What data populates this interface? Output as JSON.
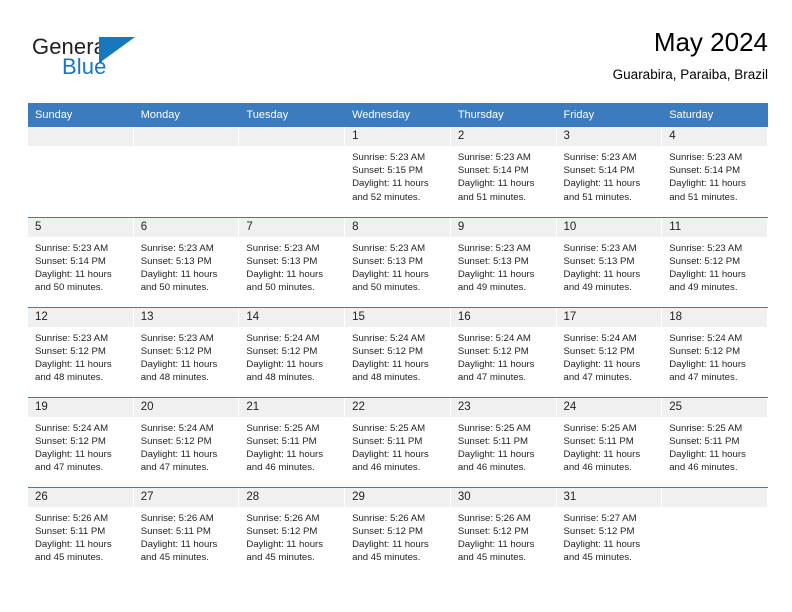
{
  "brand": {
    "name_top": "General",
    "name_bottom": "Blue",
    "flag_icon": "triangle-flag-icon",
    "accent_color": "#1878be"
  },
  "header": {
    "title": "May 2024",
    "subtitle": "Guarabira, Paraiba, Brazil"
  },
  "theme": {
    "header_blue": "#3b7cbf",
    "daynum_band": "#f0f0f0",
    "text": "#231f20"
  },
  "weekday_headers": [
    "Sunday",
    "Monday",
    "Tuesday",
    "Wednesday",
    "Thursday",
    "Friday",
    "Saturday"
  ],
  "labels": {
    "sunrise_prefix": "Sunrise:",
    "sunset_prefix": "Sunset:",
    "daylight_prefix": "Daylight:"
  },
  "weeks": [
    [
      {
        "day": "",
        "empty": true
      },
      {
        "day": "",
        "empty": true
      },
      {
        "day": "",
        "empty": true
      },
      {
        "day": "1",
        "sunrise": "Sunrise: 5:23 AM",
        "sunset": "Sunset: 5:15 PM",
        "daylight_l1": "Daylight: 11 hours",
        "daylight_l2": "and 52 minutes."
      },
      {
        "day": "2",
        "sunrise": "Sunrise: 5:23 AM",
        "sunset": "Sunset: 5:14 PM",
        "daylight_l1": "Daylight: 11 hours",
        "daylight_l2": "and 51 minutes."
      },
      {
        "day": "3",
        "sunrise": "Sunrise: 5:23 AM",
        "sunset": "Sunset: 5:14 PM",
        "daylight_l1": "Daylight: 11 hours",
        "daylight_l2": "and 51 minutes."
      },
      {
        "day": "4",
        "sunrise": "Sunrise: 5:23 AM",
        "sunset": "Sunset: 5:14 PM",
        "daylight_l1": "Daylight: 11 hours",
        "daylight_l2": "and 51 minutes."
      }
    ],
    [
      {
        "day": "5",
        "sunrise": "Sunrise: 5:23 AM",
        "sunset": "Sunset: 5:14 PM",
        "daylight_l1": "Daylight: 11 hours",
        "daylight_l2": "and 50 minutes."
      },
      {
        "day": "6",
        "sunrise": "Sunrise: 5:23 AM",
        "sunset": "Sunset: 5:13 PM",
        "daylight_l1": "Daylight: 11 hours",
        "daylight_l2": "and 50 minutes."
      },
      {
        "day": "7",
        "sunrise": "Sunrise: 5:23 AM",
        "sunset": "Sunset: 5:13 PM",
        "daylight_l1": "Daylight: 11 hours",
        "daylight_l2": "and 50 minutes."
      },
      {
        "day": "8",
        "sunrise": "Sunrise: 5:23 AM",
        "sunset": "Sunset: 5:13 PM",
        "daylight_l1": "Daylight: 11 hours",
        "daylight_l2": "and 50 minutes."
      },
      {
        "day": "9",
        "sunrise": "Sunrise: 5:23 AM",
        "sunset": "Sunset: 5:13 PM",
        "daylight_l1": "Daylight: 11 hours",
        "daylight_l2": "and 49 minutes."
      },
      {
        "day": "10",
        "sunrise": "Sunrise: 5:23 AM",
        "sunset": "Sunset: 5:13 PM",
        "daylight_l1": "Daylight: 11 hours",
        "daylight_l2": "and 49 minutes."
      },
      {
        "day": "11",
        "sunrise": "Sunrise: 5:23 AM",
        "sunset": "Sunset: 5:12 PM",
        "daylight_l1": "Daylight: 11 hours",
        "daylight_l2": "and 49 minutes."
      }
    ],
    [
      {
        "day": "12",
        "sunrise": "Sunrise: 5:23 AM",
        "sunset": "Sunset: 5:12 PM",
        "daylight_l1": "Daylight: 11 hours",
        "daylight_l2": "and 48 minutes."
      },
      {
        "day": "13",
        "sunrise": "Sunrise: 5:23 AM",
        "sunset": "Sunset: 5:12 PM",
        "daylight_l1": "Daylight: 11 hours",
        "daylight_l2": "and 48 minutes."
      },
      {
        "day": "14",
        "sunrise": "Sunrise: 5:24 AM",
        "sunset": "Sunset: 5:12 PM",
        "daylight_l1": "Daylight: 11 hours",
        "daylight_l2": "and 48 minutes."
      },
      {
        "day": "15",
        "sunrise": "Sunrise: 5:24 AM",
        "sunset": "Sunset: 5:12 PM",
        "daylight_l1": "Daylight: 11 hours",
        "daylight_l2": "and 48 minutes."
      },
      {
        "day": "16",
        "sunrise": "Sunrise: 5:24 AM",
        "sunset": "Sunset: 5:12 PM",
        "daylight_l1": "Daylight: 11 hours",
        "daylight_l2": "and 47 minutes."
      },
      {
        "day": "17",
        "sunrise": "Sunrise: 5:24 AM",
        "sunset": "Sunset: 5:12 PM",
        "daylight_l1": "Daylight: 11 hours",
        "daylight_l2": "and 47 minutes."
      },
      {
        "day": "18",
        "sunrise": "Sunrise: 5:24 AM",
        "sunset": "Sunset: 5:12 PM",
        "daylight_l1": "Daylight: 11 hours",
        "daylight_l2": "and 47 minutes."
      }
    ],
    [
      {
        "day": "19",
        "sunrise": "Sunrise: 5:24 AM",
        "sunset": "Sunset: 5:12 PM",
        "daylight_l1": "Daylight: 11 hours",
        "daylight_l2": "and 47 minutes."
      },
      {
        "day": "20",
        "sunrise": "Sunrise: 5:24 AM",
        "sunset": "Sunset: 5:12 PM",
        "daylight_l1": "Daylight: 11 hours",
        "daylight_l2": "and 47 minutes."
      },
      {
        "day": "21",
        "sunrise": "Sunrise: 5:25 AM",
        "sunset": "Sunset: 5:11 PM",
        "daylight_l1": "Daylight: 11 hours",
        "daylight_l2": "and 46 minutes."
      },
      {
        "day": "22",
        "sunrise": "Sunrise: 5:25 AM",
        "sunset": "Sunset: 5:11 PM",
        "daylight_l1": "Daylight: 11 hours",
        "daylight_l2": "and 46 minutes."
      },
      {
        "day": "23",
        "sunrise": "Sunrise: 5:25 AM",
        "sunset": "Sunset: 5:11 PM",
        "daylight_l1": "Daylight: 11 hours",
        "daylight_l2": "and 46 minutes."
      },
      {
        "day": "24",
        "sunrise": "Sunrise: 5:25 AM",
        "sunset": "Sunset: 5:11 PM",
        "daylight_l1": "Daylight: 11 hours",
        "daylight_l2": "and 46 minutes."
      },
      {
        "day": "25",
        "sunrise": "Sunrise: 5:25 AM",
        "sunset": "Sunset: 5:11 PM",
        "daylight_l1": "Daylight: 11 hours",
        "daylight_l2": "and 46 minutes."
      }
    ],
    [
      {
        "day": "26",
        "sunrise": "Sunrise: 5:26 AM",
        "sunset": "Sunset: 5:11 PM",
        "daylight_l1": "Daylight: 11 hours",
        "daylight_l2": "and 45 minutes."
      },
      {
        "day": "27",
        "sunrise": "Sunrise: 5:26 AM",
        "sunset": "Sunset: 5:11 PM",
        "daylight_l1": "Daylight: 11 hours",
        "daylight_l2": "and 45 minutes."
      },
      {
        "day": "28",
        "sunrise": "Sunrise: 5:26 AM",
        "sunset": "Sunset: 5:12 PM",
        "daylight_l1": "Daylight: 11 hours",
        "daylight_l2": "and 45 minutes."
      },
      {
        "day": "29",
        "sunrise": "Sunrise: 5:26 AM",
        "sunset": "Sunset: 5:12 PM",
        "daylight_l1": "Daylight: 11 hours",
        "daylight_l2": "and 45 minutes."
      },
      {
        "day": "30",
        "sunrise": "Sunrise: 5:26 AM",
        "sunset": "Sunset: 5:12 PM",
        "daylight_l1": "Daylight: 11 hours",
        "daylight_l2": "and 45 minutes."
      },
      {
        "day": "31",
        "sunrise": "Sunrise: 5:27 AM",
        "sunset": "Sunset: 5:12 PM",
        "daylight_l1": "Daylight: 11 hours",
        "daylight_l2": "and 45 minutes."
      },
      {
        "day": "",
        "empty": true
      }
    ]
  ]
}
